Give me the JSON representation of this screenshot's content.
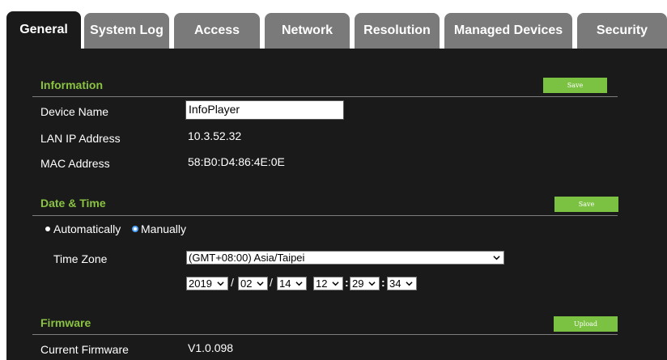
{
  "tabs": [
    {
      "label": "General",
      "active": true
    },
    {
      "label": "System Log",
      "active": false
    },
    {
      "label": "Access",
      "active": false
    },
    {
      "label": "Network",
      "active": false
    },
    {
      "label": "Resolution",
      "active": false
    },
    {
      "label": "Managed Devices",
      "active": false
    },
    {
      "label": "Security",
      "active": false
    }
  ],
  "information": {
    "title": "Information",
    "save_label": "Save",
    "device_name_label": "Device Name",
    "device_name_value": "InfoPlayer",
    "lan_ip_label": "LAN IP Address",
    "lan_ip_value": "10.3.52.32",
    "mac_label": "MAC Address",
    "mac_value": "58:B0:D4:86:4E:0E"
  },
  "datetime": {
    "title": "Date & Time",
    "save_label": "Save",
    "auto_label": "Automatically",
    "manual_label": "Manually",
    "selected_mode": "Manually",
    "timezone_label": "Time Zone",
    "timezone_value": "(GMT+08:00) Asia/Taipei",
    "year": "2019",
    "month": "02",
    "day": "14",
    "hour": "12",
    "minute": "29",
    "second": "34",
    "date_sep": "/",
    "time_sep": ":"
  },
  "firmware": {
    "title": "Firmware",
    "upload_label": "Upload",
    "current_label": "Current Firmware",
    "current_value": "V1.0.098"
  },
  "colors": {
    "accent_green": "#8ac241",
    "button_green": "#7cc242",
    "panel_bg": "#1a1a1a",
    "tab_inactive": "#7a7a7a",
    "radio_selected": "#4da3ff"
  }
}
